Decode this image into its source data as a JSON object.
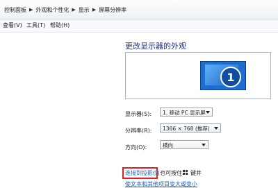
{
  "breadcrumb": [
    "控制面板",
    "外观和个性化",
    "显示",
    "屏幕分辨率"
  ],
  "menu": [
    "查看(V)",
    "工具(T)",
    "帮助(H)"
  ],
  "page_title": "更改显示器的外观",
  "monitor_badge": "1",
  "display_row": {
    "label": "显示器(S):",
    "value": "1. 移动 PC 显示屏"
  },
  "resolution_row": {
    "label": "分辨率(R):",
    "value": "1366 × 768 (推荐)"
  },
  "orientation_row": {
    "label": "方向(O):",
    "value": "横向"
  },
  "projector_link": "连接到投影仪",
  "projector_hint_1": "(也可按住",
  "projector_hint_2": "键并",
  "bottom_link": "使文本和其他项目变大或变小"
}
